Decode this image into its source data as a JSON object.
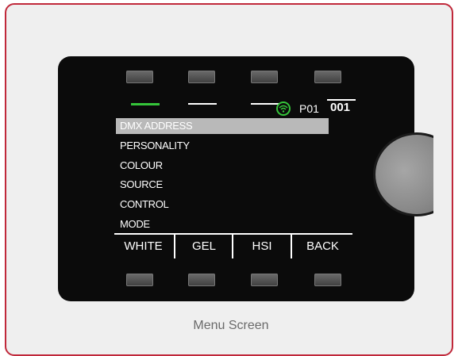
{
  "status": {
    "preset": "P01",
    "address": "001"
  },
  "menu": {
    "items": [
      {
        "label": "DMX ADDRESS",
        "selected": true
      },
      {
        "label": "PERSONALITY",
        "selected": false
      },
      {
        "label": "COLOUR",
        "selected": false
      },
      {
        "label": "SOURCE",
        "selected": false
      },
      {
        "label": "CONTROL",
        "selected": false
      },
      {
        "label": "MODE",
        "selected": false
      }
    ]
  },
  "softkeys": [
    "WHITE",
    "GEL",
    "HSI",
    "BACK"
  ],
  "caption": "Menu Screen",
  "colors": {
    "frame_border": "#c0283a",
    "active_tab": "#35c53a",
    "wifi": "#35c53a",
    "selection": "#b9b9b9"
  },
  "icons": {
    "wifi": "wifi-icon"
  }
}
